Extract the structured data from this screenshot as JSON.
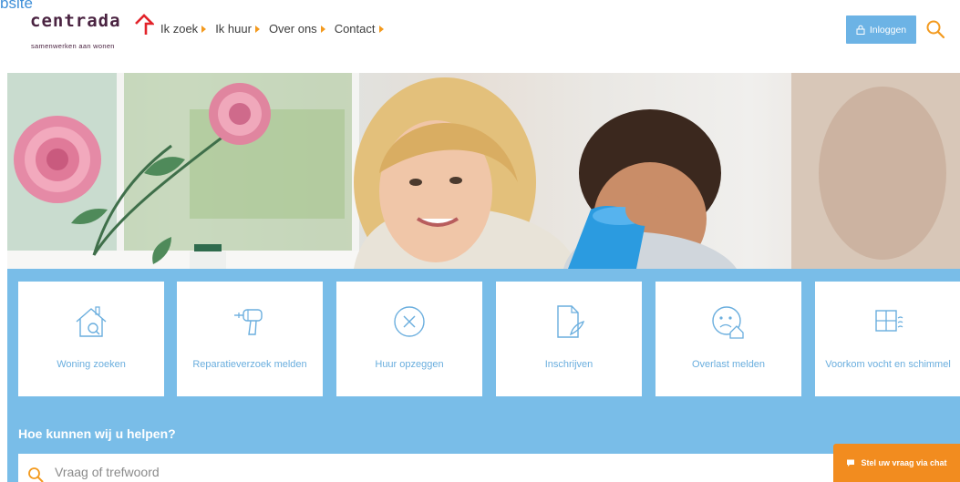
{
  "top_label": "bsite",
  "brand": {
    "name": "centrada",
    "tagline": "samenwerken aan wonen"
  },
  "nav": [
    {
      "label": "Ik zoek"
    },
    {
      "label": "Ik huur"
    },
    {
      "label": "Over ons"
    },
    {
      "label": "Contact"
    }
  ],
  "header": {
    "login_label": "Inloggen"
  },
  "tiles": [
    {
      "label": "Woning zoeken",
      "icon": "house-search-icon"
    },
    {
      "label": "Reparatieverzoek melden",
      "icon": "drill-icon"
    },
    {
      "label": "Huur opzeggen",
      "icon": "circle-x-icon"
    },
    {
      "label": "Inschrijven",
      "icon": "document-pen-icon"
    },
    {
      "label": "Overlast melden",
      "icon": "sad-face-house-icon"
    },
    {
      "label": "Voorkom vocht en schimmel",
      "icon": "window-icon"
    }
  ],
  "help": {
    "heading": "Hoe kunnen wij u helpen?",
    "search_placeholder": "Vraag of trefwoord"
  },
  "chat": {
    "label": "Stel uw vraag via chat"
  },
  "colors": {
    "brand_purple": "#4a2341",
    "accent_orange": "#f39a1e",
    "primary_blue": "#79bde8",
    "button_blue": "#6cb3e5",
    "chat_orange": "#f28c1f"
  }
}
